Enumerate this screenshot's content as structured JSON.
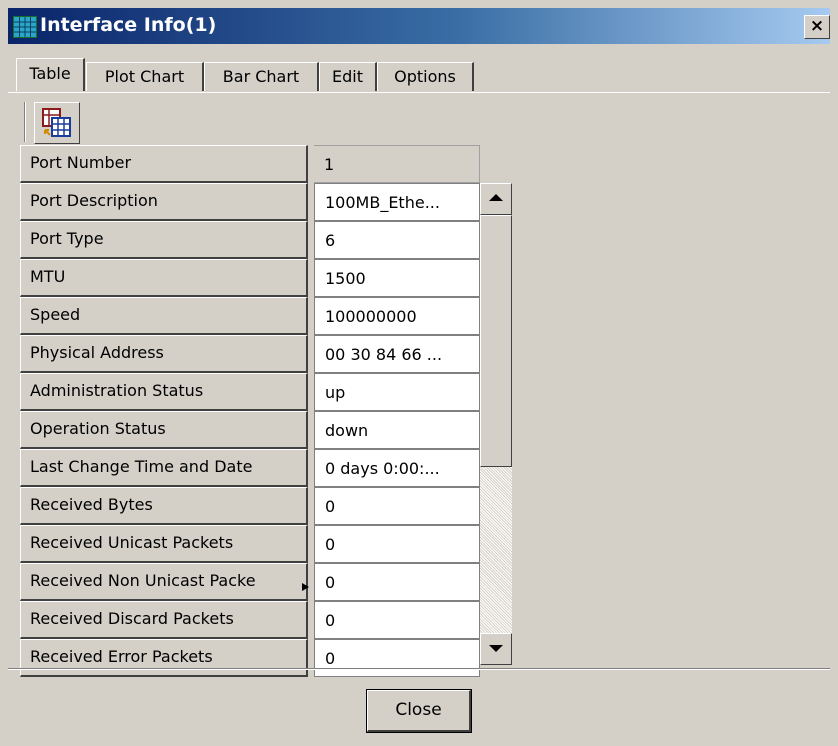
{
  "window": {
    "title": "Interface Info(1)",
    "close_glyph": "×"
  },
  "tabs": [
    {
      "label": "Table",
      "active": true
    },
    {
      "label": "Plot Chart",
      "active": false
    },
    {
      "label": "Bar Chart",
      "active": false
    },
    {
      "label": "Edit",
      "active": false
    },
    {
      "label": "Options",
      "active": false
    }
  ],
  "toolbar": {
    "button_icon": "table-export-icon"
  },
  "table": {
    "header": {
      "label": "Port Number",
      "value": "1"
    },
    "rows": [
      {
        "label": "Port Description",
        "value": "100MB_Ethe..."
      },
      {
        "label": "Port Type",
        "value": "6"
      },
      {
        "label": "MTU",
        "value": "1500"
      },
      {
        "label": "Speed",
        "value": "100000000"
      },
      {
        "label": "Physical Address",
        "value": "00 30 84 66 ..."
      },
      {
        "label": "Administration Status",
        "value": "up"
      },
      {
        "label": "Operation Status",
        "value": "down"
      },
      {
        "label": "Last Change Time and Date",
        "value": "0 days 0:00:..."
      },
      {
        "label": "Received Bytes",
        "value": "0"
      },
      {
        "label": "Received Unicast Packets",
        "value": "0"
      },
      {
        "label": "Received Non Unicast Packe",
        "value": "0"
      },
      {
        "label": "Received Discard Packets",
        "value": "0"
      },
      {
        "label": "Received Error Packets",
        "value": "0"
      }
    ]
  },
  "footer": {
    "close_label": "Close"
  },
  "colors": {
    "titlebar_start": "#0a246a",
    "titlebar_end": "#a6caf0",
    "face": "#d4d0c8"
  }
}
